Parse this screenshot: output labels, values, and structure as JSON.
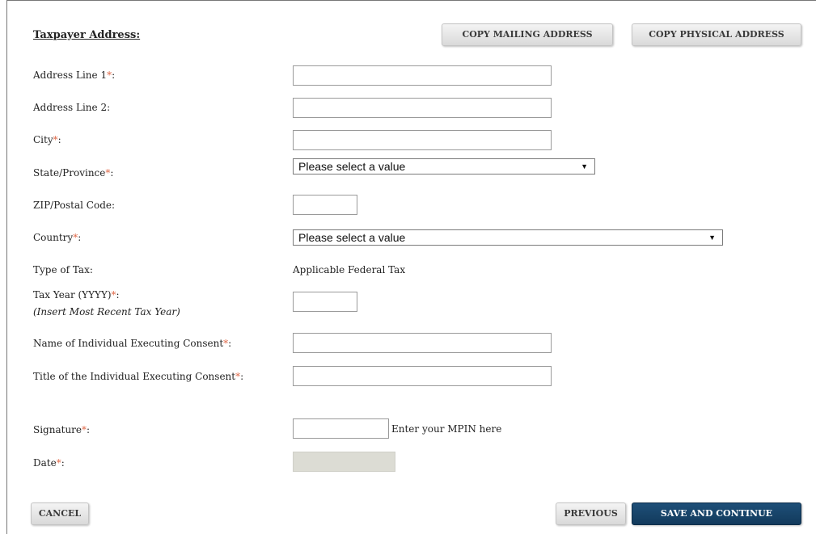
{
  "section_title": "Taxpayer Address:",
  "buttons": {
    "copy_mailing": "COPY MAILING ADDRESS",
    "copy_physical": "COPY PHYSICAL ADDRESS",
    "cancel": "CANCEL",
    "previous": "PREVIOUS",
    "save_continue": "SAVE AND CONTINUE"
  },
  "required_marker": "*",
  "fields": {
    "address1": {
      "label": "Address Line 1",
      "suffix": ":",
      "value": ""
    },
    "address2": {
      "label": "Address Line 2:",
      "value": ""
    },
    "city": {
      "label": "City",
      "suffix": ":",
      "value": ""
    },
    "state": {
      "label": "State/Province",
      "suffix": ":",
      "selected": "Please select a value"
    },
    "zip": {
      "label": "ZIP/Postal Code:",
      "value": ""
    },
    "country": {
      "label": "Country",
      "suffix": ":",
      "selected": "Please select a value"
    },
    "tax_type": {
      "label": "Type of Tax:",
      "value": "Applicable Federal Tax"
    },
    "tax_year": {
      "label": "Tax Year (YYYY)",
      "suffix": ":",
      "hint": "(Insert Most Recent Tax Year)",
      "value": ""
    },
    "exec_name": {
      "label": "Name of Individual Executing Consent",
      "suffix": ":",
      "value": ""
    },
    "exec_title": {
      "label": "Title of the Individual Executing Consent",
      "suffix": ":",
      "value": ""
    },
    "signature": {
      "label": "Signature",
      "suffix": ":",
      "value": "",
      "helper": "Enter your MPIN here"
    },
    "date": {
      "label": "Date",
      "suffix": ":",
      "value": ""
    }
  },
  "icons": {
    "select_arrow": "▼"
  },
  "colors": {
    "required": "#e06a4a",
    "primary_button": "#1e4f78",
    "disabled_field": "#dcdcd4"
  }
}
